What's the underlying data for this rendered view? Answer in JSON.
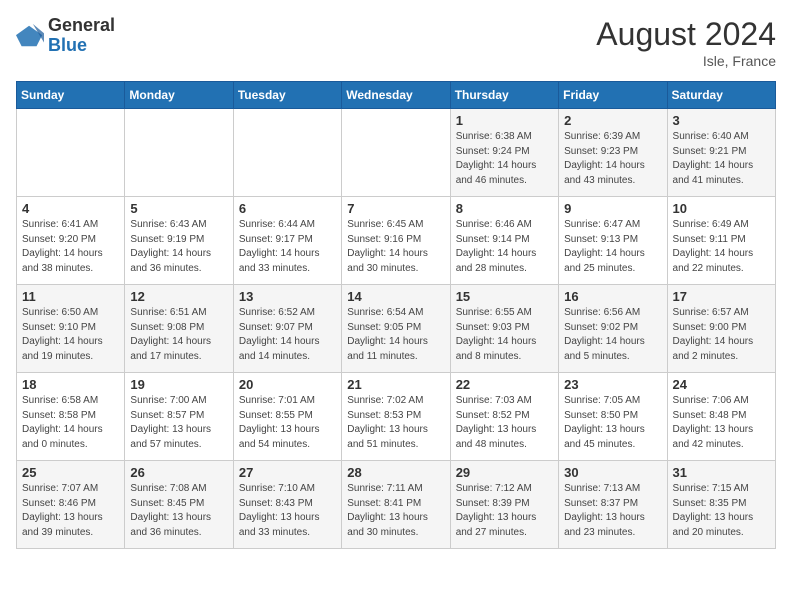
{
  "logo": {
    "general": "General",
    "blue": "Blue"
  },
  "title": "August 2024",
  "location": "Isle, France",
  "days_header": [
    "Sunday",
    "Monday",
    "Tuesday",
    "Wednesday",
    "Thursday",
    "Friday",
    "Saturday"
  ],
  "weeks": [
    [
      {
        "day": "",
        "info": ""
      },
      {
        "day": "",
        "info": ""
      },
      {
        "day": "",
        "info": ""
      },
      {
        "day": "",
        "info": ""
      },
      {
        "day": "1",
        "info": "Sunrise: 6:38 AM\nSunset: 9:24 PM\nDaylight: 14 hours\nand 46 minutes."
      },
      {
        "day": "2",
        "info": "Sunrise: 6:39 AM\nSunset: 9:23 PM\nDaylight: 14 hours\nand 43 minutes."
      },
      {
        "day": "3",
        "info": "Sunrise: 6:40 AM\nSunset: 9:21 PM\nDaylight: 14 hours\nand 41 minutes."
      }
    ],
    [
      {
        "day": "4",
        "info": "Sunrise: 6:41 AM\nSunset: 9:20 PM\nDaylight: 14 hours\nand 38 minutes."
      },
      {
        "day": "5",
        "info": "Sunrise: 6:43 AM\nSunset: 9:19 PM\nDaylight: 14 hours\nand 36 minutes."
      },
      {
        "day": "6",
        "info": "Sunrise: 6:44 AM\nSunset: 9:17 PM\nDaylight: 14 hours\nand 33 minutes."
      },
      {
        "day": "7",
        "info": "Sunrise: 6:45 AM\nSunset: 9:16 PM\nDaylight: 14 hours\nand 30 minutes."
      },
      {
        "day": "8",
        "info": "Sunrise: 6:46 AM\nSunset: 9:14 PM\nDaylight: 14 hours\nand 28 minutes."
      },
      {
        "day": "9",
        "info": "Sunrise: 6:47 AM\nSunset: 9:13 PM\nDaylight: 14 hours\nand 25 minutes."
      },
      {
        "day": "10",
        "info": "Sunrise: 6:49 AM\nSunset: 9:11 PM\nDaylight: 14 hours\nand 22 minutes."
      }
    ],
    [
      {
        "day": "11",
        "info": "Sunrise: 6:50 AM\nSunset: 9:10 PM\nDaylight: 14 hours\nand 19 minutes."
      },
      {
        "day": "12",
        "info": "Sunrise: 6:51 AM\nSunset: 9:08 PM\nDaylight: 14 hours\nand 17 minutes."
      },
      {
        "day": "13",
        "info": "Sunrise: 6:52 AM\nSunset: 9:07 PM\nDaylight: 14 hours\nand 14 minutes."
      },
      {
        "day": "14",
        "info": "Sunrise: 6:54 AM\nSunset: 9:05 PM\nDaylight: 14 hours\nand 11 minutes."
      },
      {
        "day": "15",
        "info": "Sunrise: 6:55 AM\nSunset: 9:03 PM\nDaylight: 14 hours\nand 8 minutes."
      },
      {
        "day": "16",
        "info": "Sunrise: 6:56 AM\nSunset: 9:02 PM\nDaylight: 14 hours\nand 5 minutes."
      },
      {
        "day": "17",
        "info": "Sunrise: 6:57 AM\nSunset: 9:00 PM\nDaylight: 14 hours\nand 2 minutes."
      }
    ],
    [
      {
        "day": "18",
        "info": "Sunrise: 6:58 AM\nSunset: 8:58 PM\nDaylight: 14 hours\nand 0 minutes."
      },
      {
        "day": "19",
        "info": "Sunrise: 7:00 AM\nSunset: 8:57 PM\nDaylight: 13 hours\nand 57 minutes."
      },
      {
        "day": "20",
        "info": "Sunrise: 7:01 AM\nSunset: 8:55 PM\nDaylight: 13 hours\nand 54 minutes."
      },
      {
        "day": "21",
        "info": "Sunrise: 7:02 AM\nSunset: 8:53 PM\nDaylight: 13 hours\nand 51 minutes."
      },
      {
        "day": "22",
        "info": "Sunrise: 7:03 AM\nSunset: 8:52 PM\nDaylight: 13 hours\nand 48 minutes."
      },
      {
        "day": "23",
        "info": "Sunrise: 7:05 AM\nSunset: 8:50 PM\nDaylight: 13 hours\nand 45 minutes."
      },
      {
        "day": "24",
        "info": "Sunrise: 7:06 AM\nSunset: 8:48 PM\nDaylight: 13 hours\nand 42 minutes."
      }
    ],
    [
      {
        "day": "25",
        "info": "Sunrise: 7:07 AM\nSunset: 8:46 PM\nDaylight: 13 hours\nand 39 minutes."
      },
      {
        "day": "26",
        "info": "Sunrise: 7:08 AM\nSunset: 8:45 PM\nDaylight: 13 hours\nand 36 minutes."
      },
      {
        "day": "27",
        "info": "Sunrise: 7:10 AM\nSunset: 8:43 PM\nDaylight: 13 hours\nand 33 minutes."
      },
      {
        "day": "28",
        "info": "Sunrise: 7:11 AM\nSunset: 8:41 PM\nDaylight: 13 hours\nand 30 minutes."
      },
      {
        "day": "29",
        "info": "Sunrise: 7:12 AM\nSunset: 8:39 PM\nDaylight: 13 hours\nand 27 minutes."
      },
      {
        "day": "30",
        "info": "Sunrise: 7:13 AM\nSunset: 8:37 PM\nDaylight: 13 hours\nand 23 minutes."
      },
      {
        "day": "31",
        "info": "Sunrise: 7:15 AM\nSunset: 8:35 PM\nDaylight: 13 hours\nand 20 minutes."
      }
    ]
  ]
}
